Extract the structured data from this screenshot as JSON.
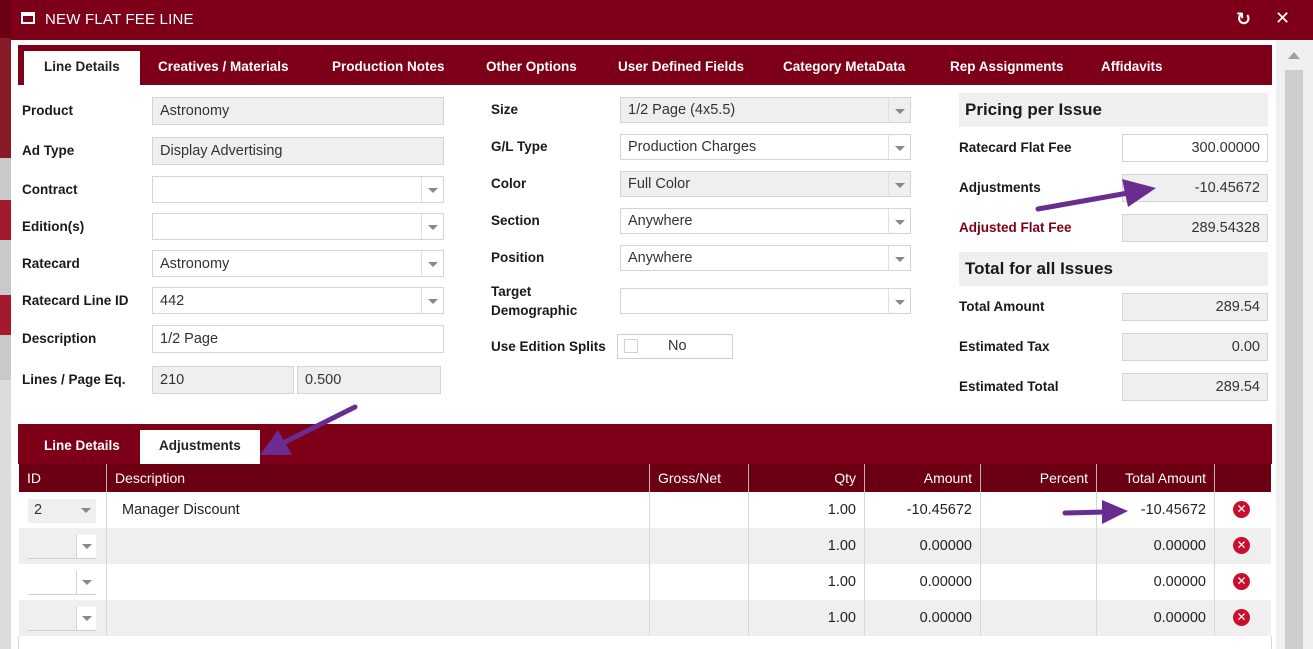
{
  "dialog": {
    "title": "NEW FLAT FEE LINE",
    "refresh_icon": "refresh-icon",
    "close_icon": "close-icon"
  },
  "tabs": [
    {
      "label": "Line Details",
      "active": true
    },
    {
      "label": "Creatives / Materials"
    },
    {
      "label": "Production Notes"
    },
    {
      "label": "Other Options"
    },
    {
      "label": "User Defined Fields"
    },
    {
      "label": "Category MetaData"
    },
    {
      "label": "Rep Assignments"
    },
    {
      "label": "Affidavits"
    }
  ],
  "left": {
    "product": {
      "label": "Product",
      "value": "Astronomy"
    },
    "ad_type": {
      "label": "Ad Type",
      "value": "Display Advertising"
    },
    "contract": {
      "label": "Contract",
      "value": ""
    },
    "editions": {
      "label": "Edition(s)",
      "value": ""
    },
    "ratecard": {
      "label": "Ratecard",
      "value": "Astronomy"
    },
    "ratecard_line_id": {
      "label": "Ratecard Line ID",
      "value": "442"
    },
    "description": {
      "label": "Description",
      "value": "1/2 Page"
    },
    "lines_page_eq": {
      "label": "Lines / Page Eq.",
      "value1": "210",
      "value2": "0.500"
    }
  },
  "middle": {
    "size": {
      "label": "Size",
      "value": "1/2 Page (4x5.5)"
    },
    "gl_type": {
      "label": "G/L Type",
      "value": "Production Charges"
    },
    "color": {
      "label": "Color",
      "value": "Full Color"
    },
    "section": {
      "label": "Section",
      "value": "Anywhere"
    },
    "position": {
      "label": "Position",
      "value": "Anywhere"
    },
    "target_demographic": {
      "label_line1": "Target",
      "label_line2": "Demographic",
      "value": ""
    },
    "use_edition_splits": {
      "label": "Use Edition Splits",
      "value": "No"
    }
  },
  "pricing": {
    "header": "Pricing per Issue",
    "ratecard_flat_fee": {
      "label": "Ratecard Flat Fee",
      "value": "300.00000"
    },
    "adjustments": {
      "label": "Adjustments",
      "value": "-10.45672"
    },
    "adjusted_flat_fee": {
      "label": "Adjusted Flat Fee",
      "value": "289.54328"
    }
  },
  "totals": {
    "header": "Total for all Issues",
    "total_amount": {
      "label": "Total Amount",
      "value": "289.54"
    },
    "estimated_tax": {
      "label": "Estimated Tax",
      "value": "0.00"
    },
    "estimated_total": {
      "label": "Estimated Total",
      "value": "289.54"
    }
  },
  "subtabs": [
    {
      "label": "Line Details"
    },
    {
      "label": "Adjustments",
      "active": true
    }
  ],
  "grid": {
    "columns": [
      "ID",
      "Description",
      "Gross/Net",
      "Qty",
      "Amount",
      "Percent",
      "Total Amount"
    ],
    "rows": [
      {
        "id": "2",
        "description": "Manager Discount",
        "gross_net": "",
        "qty": "1.00",
        "amount": "-10.45672",
        "percent": "",
        "total": "-10.45672"
      },
      {
        "id": "",
        "description": "",
        "gross_net": "",
        "qty": "1.00",
        "amount": "0.00000",
        "percent": "",
        "total": "0.00000"
      },
      {
        "id": "",
        "description": "",
        "gross_net": "",
        "qty": "1.00",
        "amount": "0.00000",
        "percent": "",
        "total": "0.00000"
      },
      {
        "id": "",
        "description": "",
        "gross_net": "",
        "qty": "1.00",
        "amount": "0.00000",
        "percent": "",
        "total": "0.00000"
      }
    ],
    "delete_icon": "delete-icon"
  },
  "colors": {
    "brand": "#7d0018",
    "header_dark": "#6b0012",
    "annotation_arrow": "#6a2c91",
    "delete": "#c8102e"
  }
}
